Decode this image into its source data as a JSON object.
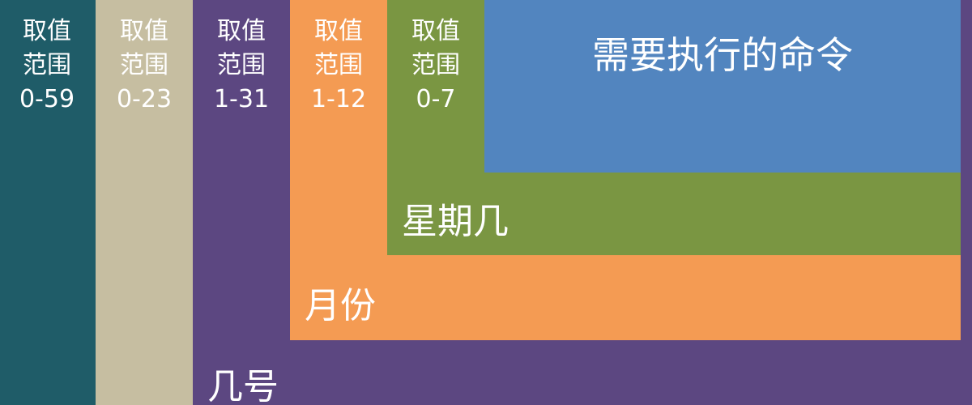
{
  "fields": [
    {
      "range_label": "取值",
      "range_label2": "范围",
      "range": "0-59",
      "color": "#1f5c68"
    },
    {
      "range_label": "取值",
      "range_label2": "范围",
      "range": "0-23",
      "color": "#c6bea1"
    },
    {
      "range_label": "取值",
      "range_label2": "范围",
      "range": "1-31",
      "color": "#5c4781",
      "name": "几号"
    },
    {
      "range_label": "取值",
      "range_label2": "范围",
      "range": "1-12",
      "color": "#f49b53",
      "name": "月份"
    },
    {
      "range_label": "取值",
      "range_label2": "范围",
      "range": "0-7",
      "color": "#7a9642",
      "name": "星期几"
    }
  ],
  "command": {
    "label": "需要执行的命令",
    "color": "#5285bf"
  }
}
